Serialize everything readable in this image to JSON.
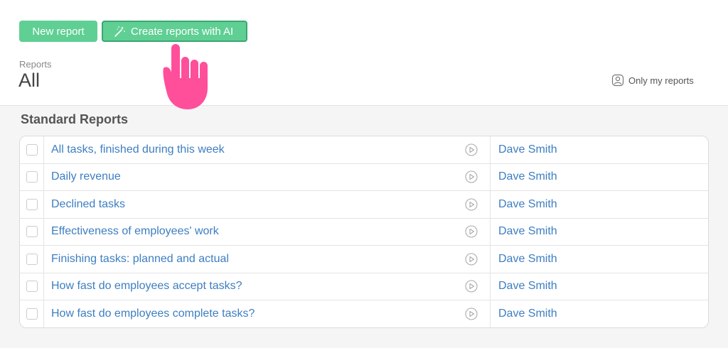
{
  "toolbar": {
    "new_report_label": "New report",
    "ai_report_label": "Create reports with AI"
  },
  "header": {
    "breadcrumb": "Reports",
    "title": "All",
    "filter_label": "Only my reports"
  },
  "section": {
    "title": "Standard Reports"
  },
  "reports": [
    {
      "name": "All tasks, finished during this week",
      "owner": "Dave Smith"
    },
    {
      "name": "Daily revenue",
      "owner": "Dave Smith"
    },
    {
      "name": "Declined tasks",
      "owner": "Dave Smith"
    },
    {
      "name": "Effectiveness of employees' work",
      "owner": "Dave Smith"
    },
    {
      "name": "Finishing tasks: planned and actual",
      "owner": "Dave Smith"
    },
    {
      "name": "How fast do employees accept tasks?",
      "owner": "Dave Smith"
    },
    {
      "name": "How fast do employees complete tasks?",
      "owner": "Dave Smith"
    }
  ],
  "icons": {
    "ai": "magic-wand-icon",
    "filter": "user-icon",
    "run": "play-circle-icon",
    "pointer": "pointing-hand-icon"
  },
  "colors": {
    "button_green": "#5fcf93",
    "link_blue": "#3d7ec1",
    "pointer_pink": "#ff4f9a"
  }
}
